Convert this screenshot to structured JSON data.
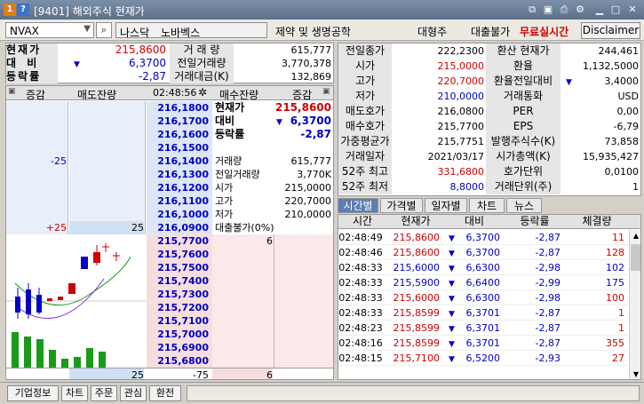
{
  "window": {
    "title": "[9401] 해외주식 현재가",
    "n1": "1",
    "n2": "?"
  },
  "toolbar": {
    "symbol": "NVAX",
    "exchange": "나스닥",
    "name": "노바벡스",
    "sector": "제약 및 생명공학",
    "size": "대형주",
    "loan": "대출불가",
    "realtime": "무료실시간",
    "disclaimer": "Disclaimer"
  },
  "summary": {
    "price_label": "현재가",
    "price": "215,8600",
    "change_label": "대 비",
    "change": "6,3700",
    "rate_label": "등락률",
    "rate": "-2,87",
    "vol_label": "거 래 량",
    "vol": "615,777",
    "prevvol_label": "전일거래량",
    "prevvol": "3,770,378",
    "amount_label": "거래대금(K)",
    "amount": "132,869"
  },
  "orderbook": {
    "headers": {
      "left": "증감",
      "ask": "매도잔량",
      "time": "02:48:56",
      "bid": "매수잔량",
      "right": "증감"
    },
    "asks": [
      "216,1800",
      "216,1700",
      "216,1600",
      "216,1500",
      "216,1400",
      "216,1300",
      "216,1200",
      "216,1100",
      "216,1000",
      "216,0900"
    ],
    "ask_changes": {
      "r4": "-25",
      "r9": "+25",
      "r9qty": "25"
    },
    "bids": [
      "215,7700",
      "215,7600",
      "215,7500",
      "215,7400",
      "215,7300",
      "215,7200",
      "215,7100",
      "215,7000",
      "215,6900",
      "215,6800"
    ],
    "bid_qty0": "6",
    "info": {
      "price_label": "현재가",
      "price": "215,8600",
      "change_label": "대비",
      "change": "6,3700",
      "rate_label": "등락률",
      "rate": "-2,87",
      "rows": [
        [
          "거래량",
          "615,777"
        ],
        [
          "전일거래량",
          "3,770K"
        ],
        [
          "시가",
          "215,0000"
        ],
        [
          "고가",
          "220,7000"
        ],
        [
          "저가",
          "210,0000"
        ],
        [
          "대출불가(0%)",
          ""
        ]
      ]
    },
    "footer": {
      "askqty": "25",
      "diff": "-75",
      "bidqty": "6"
    }
  },
  "info": {
    "left": [
      [
        "전일종가",
        "222,2300"
      ],
      [
        "시가",
        "215,0000"
      ],
      [
        "고가",
        "220,7000"
      ],
      [
        "저가",
        "210,0000"
      ],
      [
        "매도호가",
        "216,0800"
      ],
      [
        "매수호가",
        "215,7700"
      ],
      [
        "가중평균가",
        "215,7751"
      ],
      [
        "거래일자",
        "2021/03/17"
      ],
      [
        "52주 최고",
        "331,6800"
      ],
      [
        "52주 최저",
        "8,8000"
      ]
    ],
    "right": [
      [
        "환산 현재가",
        "244,461"
      ],
      [
        "환율",
        "1,132,5000"
      ],
      [
        "환율전일대비",
        "3,4000"
      ],
      [
        "거래통화",
        "USD"
      ],
      [
        "PER",
        "0,00"
      ],
      [
        "EPS",
        "-6,79"
      ],
      [
        "발행주식수(K)",
        "73,858"
      ],
      [
        "시가총액(K)",
        "15,935,427"
      ],
      [
        "호가단위",
        "0,0100"
      ],
      [
        "거래단위(주)",
        "1"
      ]
    ]
  },
  "tabs": [
    "시간별",
    "가격별",
    "일자별",
    "차트",
    "뉴스"
  ],
  "trades": {
    "headers": [
      "시간",
      "현재가",
      "대비",
      "등락률",
      "체결량"
    ],
    "rows": [
      [
        "02:48:49",
        "215,8600",
        "6,3700",
        "-2,87",
        "11"
      ],
      [
        "02:48:46",
        "215,8600",
        "6,3700",
        "-2,87",
        "128"
      ],
      [
        "02:48:33",
        "215,6000",
        "6,6300",
        "-2,98",
        "102"
      ],
      [
        "02:48:33",
        "215,5900",
        "6,6400",
        "-2,99",
        "175"
      ],
      [
        "02:48:33",
        "215,6000",
        "6,6300",
        "-2,98",
        "100"
      ],
      [
        "02:48:33",
        "215,8599",
        "6,3701",
        "-2,87",
        "1"
      ],
      [
        "02:48:23",
        "215,8599",
        "6,3701",
        "-2,87",
        "1"
      ],
      [
        "02:48:16",
        "215,8599",
        "6,3701",
        "-2,87",
        "355"
      ],
      [
        "02:48:15",
        "215,7100",
        "6,5200",
        "-2,93",
        "27"
      ]
    ],
    "row_colors": [
      "red",
      "red",
      "blue",
      "blue",
      "red",
      "red",
      "red",
      "red",
      "red"
    ]
  },
  "bottom": [
    "기업정보",
    "차트",
    "주문",
    "관심",
    "환전"
  ]
}
